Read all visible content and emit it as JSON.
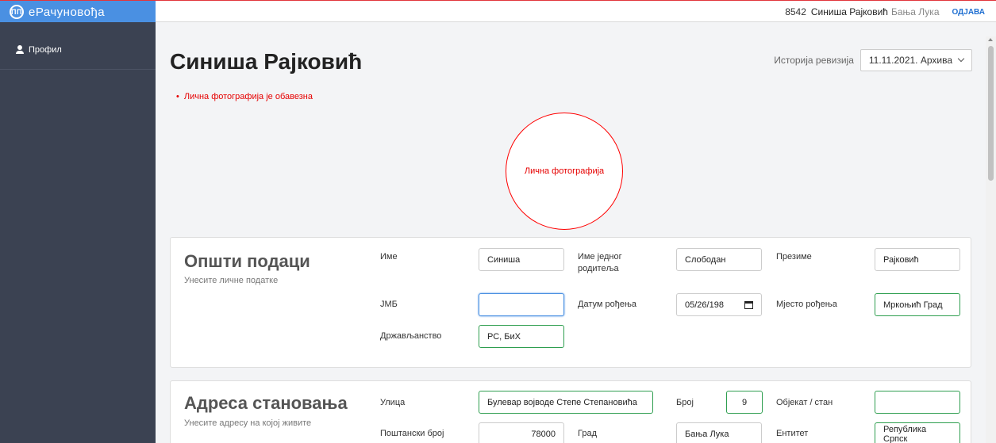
{
  "brand": {
    "name": "еРачуновођа",
    "logo_text": "ПП"
  },
  "topbar": {
    "user_id": "8542",
    "user_name": "Синиша Рајковић",
    "user_city": "Бања Лука",
    "logout": "ОДЈАВА"
  },
  "sidebar": {
    "items": [
      {
        "label": "Профил",
        "icon": "person-icon"
      }
    ]
  },
  "page": {
    "title": "Синиша Рајковић",
    "revision_label": "Историја ревизија",
    "revision_value": "11.11.2021. Архива",
    "errors": [
      "Лична фотографија је обавезна"
    ],
    "photo_label": "Лична фотографија"
  },
  "general": {
    "title": "Општи подаци",
    "subtitle": "Унесите личне податке",
    "ime_label": "Име",
    "ime": "Синиша",
    "roditelj_label": "Име једног родитеља",
    "roditelj": "Слободан",
    "prezime_label": "Презиме",
    "prezime": "Рајковић",
    "jmb_label": "ЈМБ",
    "jmb": "",
    "datum_label": "Датум рођења",
    "datum": "05/26/198",
    "mjesto_label": "Мјесто рођења",
    "mjesto": "Мркоњић Град",
    "drzavljanstvo_label": "Држављанство",
    "drzavljanstvo": "РС, БиХ"
  },
  "address": {
    "title": "Адреса становања",
    "subtitle": "Унесите адресу на којој живите",
    "ulica_label": "Улица",
    "ulica": "Булевар војводе Степе Степановића",
    "broj_label": "Број",
    "broj": "9",
    "objekat_label": "Објекат / стан",
    "objekat": "",
    "postanski_label": "Поштански број",
    "postanski": "78000",
    "grad_label": "Град",
    "grad": "Бања Лука",
    "entitet_label": "Ентитет",
    "entitet": "Република Српск"
  },
  "colors": {
    "brand": "#4a90e2",
    "sidebar": "#3b4252",
    "error": "#e60000",
    "valid": "#2e9e4f"
  }
}
